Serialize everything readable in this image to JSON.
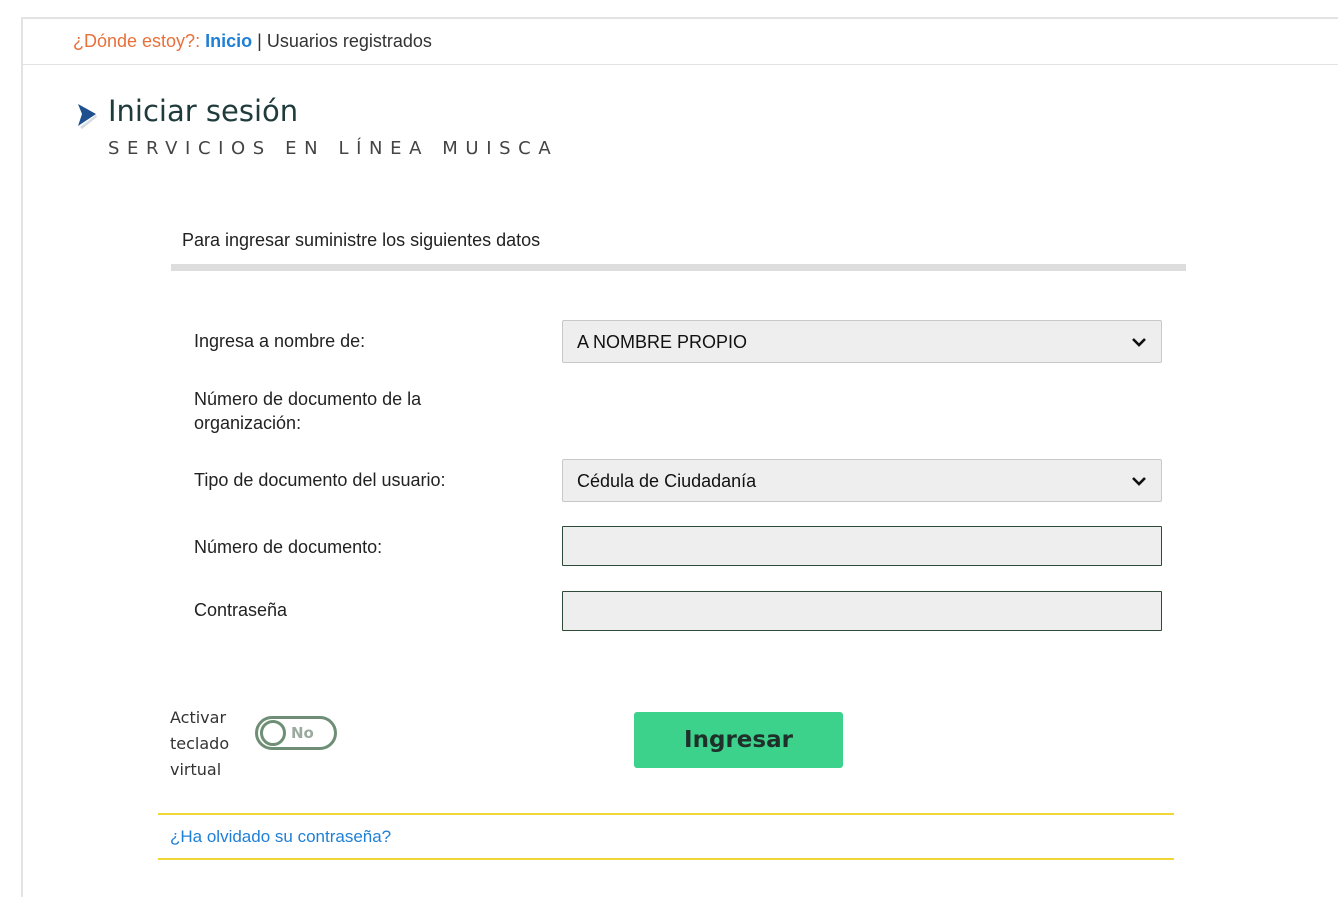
{
  "breadcrumb": {
    "prefix": "¿Dónde estoy?:",
    "home": "Inicio",
    "separator": "|",
    "current": "Usuarios registrados"
  },
  "header": {
    "title": "Iniciar sesión",
    "subtitle": "SERVICIOS EN LÍNEA MUISCA",
    "arrow_color": "#1f4f8f"
  },
  "form": {
    "instructions": "Para ingresar suministre los siguientes datos",
    "fields": {
      "on_behalf": {
        "label": "Ingresa a nombre de:",
        "value": "A NOMBRE PROPIO"
      },
      "org_document": {
        "label_line1": "Número de documento de la",
        "label_line2": "organización:"
      },
      "doc_type": {
        "label": "Tipo de documento del usuario:",
        "value": "Cédula de Ciudadanía"
      },
      "doc_number": {
        "label": "Número de documento:",
        "value": ""
      },
      "password": {
        "label": "Contraseña",
        "value": ""
      }
    },
    "virtual_keyboard": {
      "label_line1": "Activar",
      "label_line2": "teclado",
      "label_line3": "virtual",
      "state": "No"
    },
    "submit_label": "Ingresar",
    "forgot_password": "¿Ha olvidado su contraseña?"
  },
  "colors": {
    "link": "#1f7fd6",
    "prefix": "#e8703a",
    "button": "#3dd28b",
    "gold_rule": "#f0d637"
  },
  "icons": {
    "title_arrow": "triangle-right-icon",
    "select_chevron": "chevron-down-icon"
  }
}
